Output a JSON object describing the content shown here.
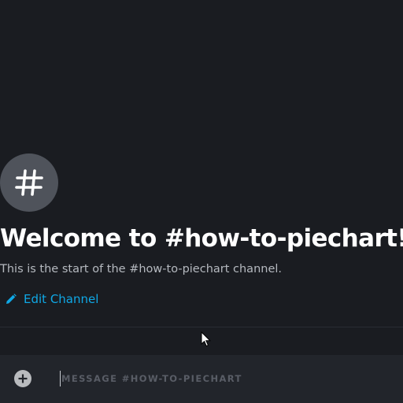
{
  "channel": {
    "avatar_icon": "hash-icon",
    "welcome_title": "Welcome to #how-to-piechart!",
    "welcome_subtitle": "This is the start of the #how-to-piechart channel.",
    "edit_channel_label": "Edit Channel",
    "edit_icon": "pencil-icon"
  },
  "composer": {
    "add_icon": "plus-circle-icon",
    "placeholder": "MESSAGE #HOW-TO-PIECHART"
  },
  "colors": {
    "background": "#1a1c21",
    "composer_background": "#22252b",
    "avatar_background": "#4f535b",
    "title": "#ffffff",
    "subtitle": "#b5b9bf",
    "link_accent": "#0fa8e6",
    "placeholder": "#595d66"
  }
}
